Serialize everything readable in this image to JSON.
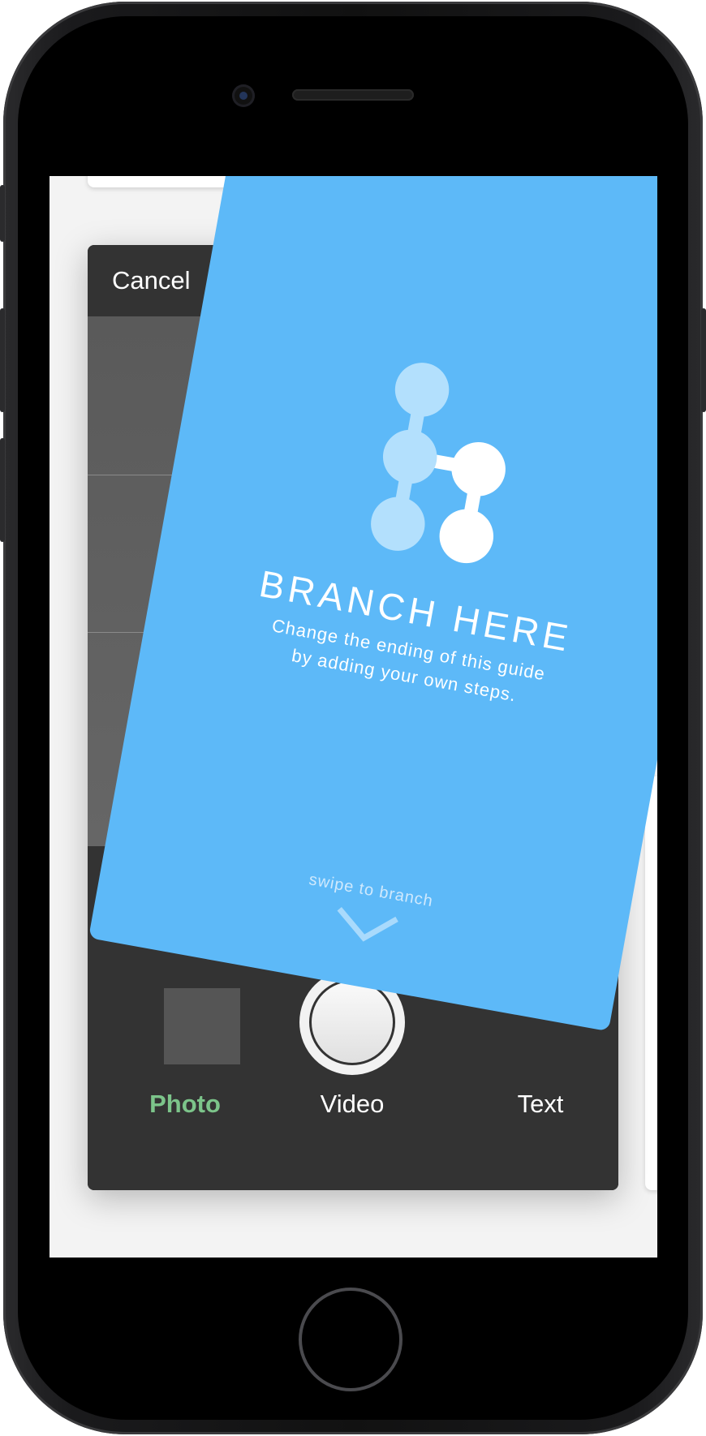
{
  "camera": {
    "cancel_label": "Cancel",
    "modes": [
      {
        "label": "Photo",
        "active": true
      },
      {
        "label": "Video",
        "active": false
      },
      {
        "label": "Text",
        "active": false
      }
    ]
  },
  "branch_card": {
    "title": "BRANCH HERE",
    "subtitle_line1": "Change the ending of this guide",
    "subtitle_line2": "by adding your own steps.",
    "swipe_hint": "swipe to branch",
    "icon": "branch-nodes-icon",
    "colors": {
      "card": "#5db9f8",
      "node_light": "#b3e0fd",
      "node_white": "#ffffff"
    }
  },
  "colors": {
    "active_mode": "#7cc48a",
    "panel": "#333333"
  }
}
